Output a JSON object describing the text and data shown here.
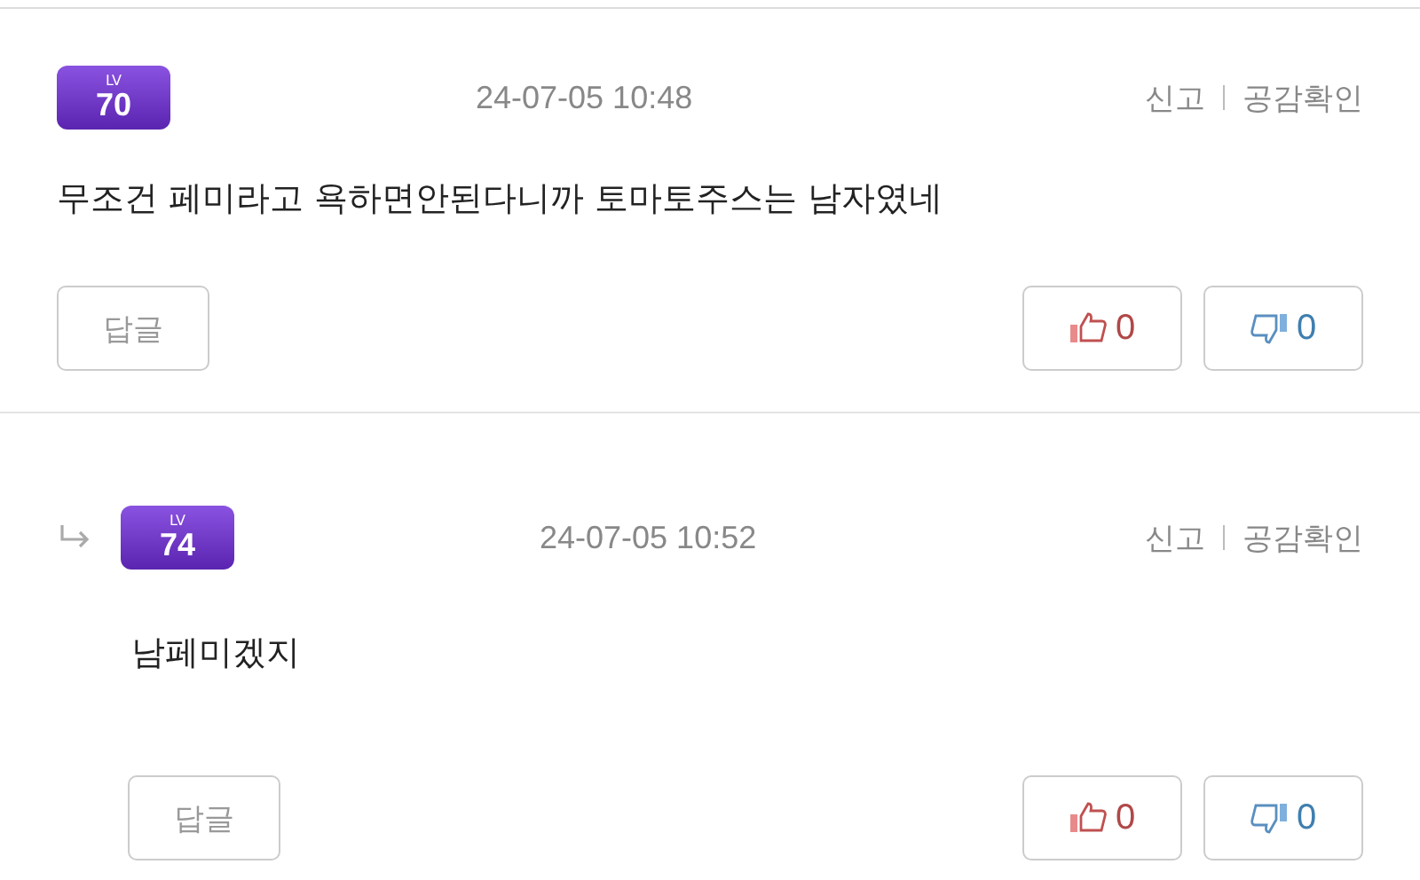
{
  "comments": [
    {
      "is_reply": false,
      "badge": {
        "label": "LV",
        "number": "70"
      },
      "time": "24-07-05 10:48",
      "actions": [
        "신고",
        "공감확인"
      ],
      "text": "무조건 페미라고 욕하면안된다니까 토마토주스는 남자였네",
      "reply_button": "답글",
      "likes": "0",
      "dislikes": "0"
    },
    {
      "is_reply": true,
      "badge": {
        "label": "LV",
        "number": "74"
      },
      "time": "24-07-05 10:52",
      "actions": [
        "신고",
        "공감확인"
      ],
      "text": "남페미겠지",
      "reply_button": "답글",
      "likes": "0",
      "dislikes": "0"
    }
  ]
}
